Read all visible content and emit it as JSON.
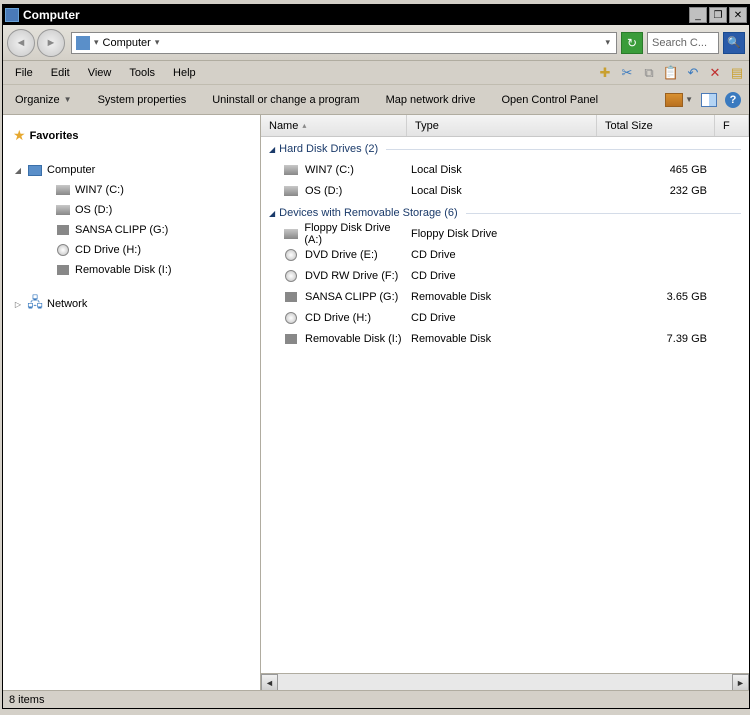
{
  "title": "Computer",
  "winbtns": {
    "min": "_",
    "restore": "❐",
    "close": "✕"
  },
  "address": {
    "label": "Computer",
    "dropdown": "▾",
    "back": "◄",
    "fwd": "►"
  },
  "search": {
    "placeholder": "Search C..."
  },
  "menus": [
    "File",
    "Edit",
    "View",
    "Tools",
    "Help"
  ],
  "cmdbar": {
    "organize": "Organize",
    "sysprops": "System properties",
    "uninstall": "Uninstall or change a program",
    "mapdrive": "Map network drive",
    "controlpanel": "Open Control Panel"
  },
  "cols": {
    "name": "Name",
    "type": "Type",
    "size": "Total Size",
    "free": "F"
  },
  "navpane": {
    "favorites": "Favorites",
    "computer": "Computer",
    "children": [
      {
        "label": "WIN7 (C:)",
        "icon": "hdd"
      },
      {
        "label": "OS (D:)",
        "icon": "hdd"
      },
      {
        "label": "SANSA CLIPP (G:)",
        "icon": "usb"
      },
      {
        "label": "CD Drive (H:)",
        "icon": "cd"
      },
      {
        "label": "Removable Disk (I:)",
        "icon": "usb"
      }
    ],
    "network": "Network"
  },
  "groups": [
    {
      "title": "Hard Disk Drives (2)",
      "items": [
        {
          "name": "WIN7 (C:)",
          "type": "Local Disk",
          "size": "465 GB",
          "icon": "hdd"
        },
        {
          "name": "OS (D:)",
          "type": "Local Disk",
          "size": "232 GB",
          "icon": "hdd"
        }
      ]
    },
    {
      "title": "Devices with Removable Storage (6)",
      "items": [
        {
          "name": "Floppy Disk Drive (A:)",
          "type": "Floppy Disk Drive",
          "size": "",
          "icon": "hdd"
        },
        {
          "name": "DVD Drive (E:)",
          "type": "CD Drive",
          "size": "",
          "icon": "cd"
        },
        {
          "name": "DVD RW Drive (F:)",
          "type": "CD Drive",
          "size": "",
          "icon": "cd"
        },
        {
          "name": "SANSA CLIPP (G:)",
          "type": "Removable Disk",
          "size": "3.65 GB",
          "icon": "usb"
        },
        {
          "name": "CD Drive (H:)",
          "type": "CD Drive",
          "size": "",
          "icon": "cd"
        },
        {
          "name": "Removable Disk (I:)",
          "type": "Removable Disk",
          "size": "7.39 GB",
          "icon": "usb"
        }
      ]
    }
  ],
  "status": "8 items"
}
